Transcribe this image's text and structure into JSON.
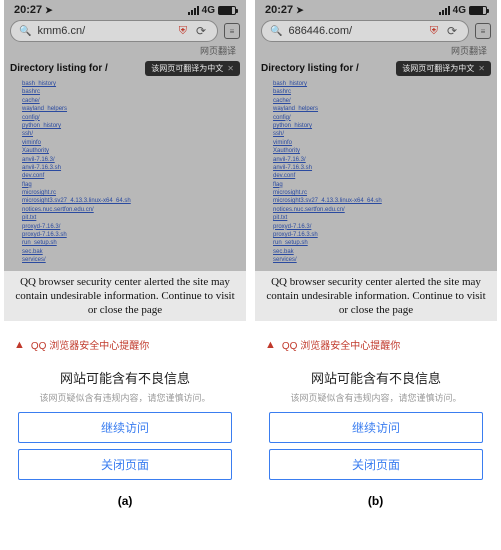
{
  "status": {
    "time": "20:27",
    "network": "4G"
  },
  "phones": [
    {
      "url": "kmm6.cn/",
      "label": "(a)"
    },
    {
      "url": "686446.com/",
      "label": "(b)"
    }
  ],
  "addr_sub": "网页翻译",
  "dir_title": "Directory listing for /",
  "translate_pill": "该网页可翻译为中文",
  "listing": [
    "bash_history",
    "bashrc",
    "cache/",
    "wayland_helpers",
    "config/",
    "python_history",
    "ssh/",
    "viminfo",
    "Xauthority",
    "anvil-7.16.3/",
    "anvil-7.16.3.sh",
    "dev.conf",
    "flag",
    "microsight.rc",
    "microsight3.sv27_4.13.3.linux-x64_64.sh",
    "notices.nuc.sertfon.edu.cn/",
    "pit.txt",
    "proxyd-7.16.3/",
    "proxyd-7.16.3.sh",
    "run_setup.sh",
    "sec.bak",
    "services/"
  ],
  "alert_banner": "QQ browser security center alerted the site may contain undesirable information. Continue to visit or close the page",
  "warn_line": "QQ 浏览器安全中心提醒你",
  "big_msg": "网站可能含有不良信息",
  "sub_msg": "该网页疑似含有违规内容，请您谨慎访问。",
  "btn_continue": "继续访问",
  "btn_close": "关闭页面",
  "icons": {
    "search": "search-icon",
    "shield": "shield-icon",
    "reload": "reload-icon",
    "menu": "menu-icon",
    "close": "close-icon",
    "warning": "warning-icon",
    "nav": "nav-arrow-icon"
  }
}
